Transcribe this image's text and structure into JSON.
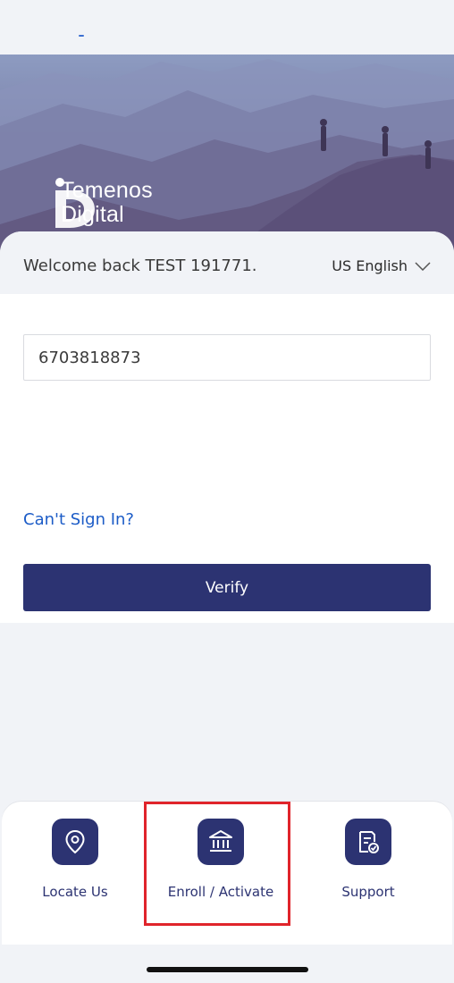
{
  "brand": {
    "line1": "Temenos",
    "line2": "Digital"
  },
  "login": {
    "welcome_text": "Welcome back TEST 191771.",
    "language": "US English",
    "phone_value": "6703818873",
    "cant_sign_in": "Can't Sign In?",
    "verify_label": "Verify"
  },
  "tabs": [
    {
      "label": "Locate Us",
      "icon": "location-pin-icon"
    },
    {
      "label": "Enroll / Activate",
      "icon": "bank-building-icon",
      "highlighted": true
    },
    {
      "label": "Support",
      "icon": "document-check-icon"
    }
  ],
  "colors": {
    "primary": "#2c3372",
    "link": "#1c5cc7",
    "highlight": "#e0242b",
    "background": "#f1f3f7"
  }
}
